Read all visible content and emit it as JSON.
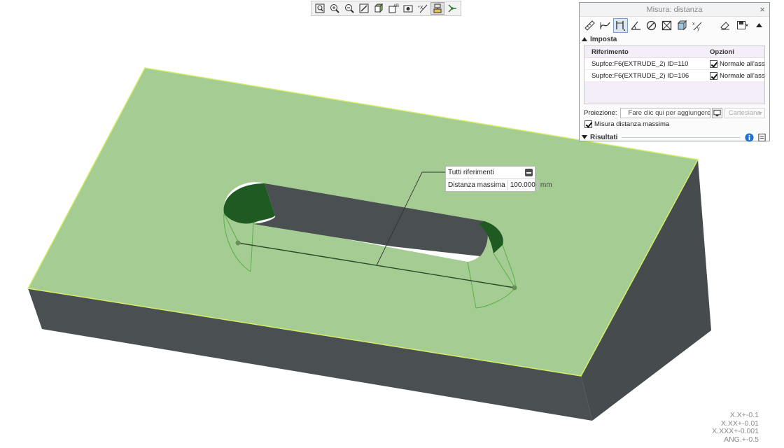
{
  "graphics_toolbar": {
    "buttons": [
      {
        "name": "refit",
        "icon": "refit-icon"
      },
      {
        "name": "zoom-in",
        "icon": "zoom-in-icon"
      },
      {
        "name": "zoom-out",
        "icon": "zoom-out-icon"
      },
      {
        "name": "repaint",
        "icon": "repaint-icon"
      },
      {
        "name": "display-style",
        "icon": "display-style-icon"
      },
      {
        "name": "saved-orientations",
        "icon": "saved-orientations-icon"
      },
      {
        "name": "view-manager",
        "icon": "view-manager-icon"
      },
      {
        "name": "annotation-display",
        "icon": "annotation-display-icon"
      },
      {
        "name": "datum-display",
        "icon": "datum-display-icon",
        "active": true
      },
      {
        "name": "spin-center",
        "icon": "spin-center-icon"
      }
    ]
  },
  "callout": {
    "title": "Tutti riferimenti",
    "label": "Distanza massima",
    "value": "100.000",
    "unit": "mm"
  },
  "dialog": {
    "title": "Misura: distanza",
    "close": "×",
    "tools": [
      "length",
      "curve-length",
      "distance",
      "angle",
      "diameter",
      "area",
      "volume",
      "transform"
    ],
    "setup_label": "Imposta",
    "columns": {
      "reference": "Riferimento",
      "options": "Opzioni"
    },
    "rows": [
      {
        "reference": "Supfce:F6(EXTRUDE_2) ID=110",
        "option": "Normale all'asse",
        "checked": true
      },
      {
        "reference": "Supfce:F6(EXTRUDE_2) ID=106",
        "option": "Normale all'asse",
        "checked": true
      }
    ],
    "projection_label": "Proiezione:",
    "projection_placeholder": "Fare clic qui per aggiungere un elemento",
    "projection_mode": "Cartesiana",
    "max_distance_label": "Misura distanza massima",
    "results_label": "Risultati"
  },
  "tolerance": [
    "X.X+-0.1",
    "X.XX+-0.01",
    "X.XXX+-0.001",
    "ANG.+-0.5"
  ],
  "colors": {
    "top_face": "#a5cc93",
    "side_face": "#4a4f52",
    "edge_highlight": "#d3ef6a",
    "slot_end": "#1e5a22",
    "dialog_border": "#8e9aa8"
  }
}
